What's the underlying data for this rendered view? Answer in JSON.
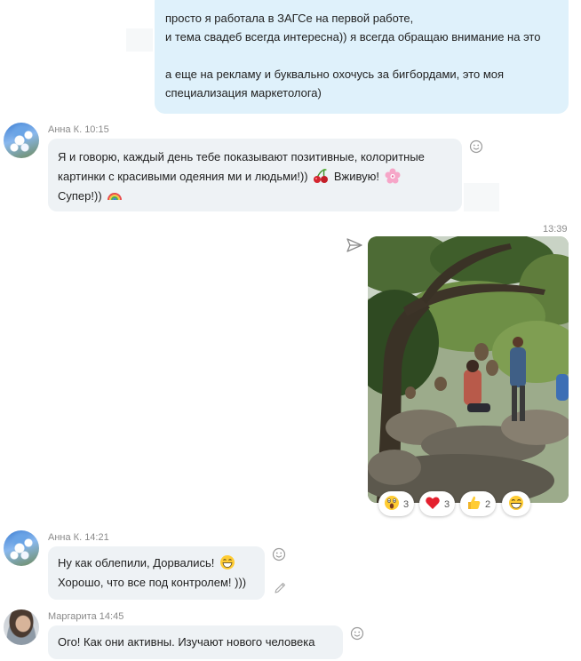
{
  "outgoing_top": {
    "lines": [
      "просто я работала в ЗАГСе на первой работе,",
      "и тема свадеб всегда интересна)) я всегда обращаю внимание на это",
      "",
      "а еще на рекламу и буквально охочусь за бигбордами, это моя",
      "специализация маркетолога)"
    ]
  },
  "messages": [
    {
      "author": "Анна К.",
      "time": "10:15",
      "lines": [
        "Я и говорю, каждый день тебе показывают  позитивные, колоритные",
        "картинки с красивыми одеяния ми и людьми!))",
        "Вживую!",
        "Супер!))"
      ],
      "emojis": [
        "cherries-emoji",
        "cherry-blossom-emoji",
        "rainbow-emoji"
      ]
    },
    {
      "author": "Анна К.",
      "time": "14:21",
      "lines": [
        "Ну как облепили, Дорвались!",
        "Хорошо, что все под контролем! )))"
      ],
      "emojis": [
        "grinning-emoji"
      ]
    },
    {
      "author": "Маргарита",
      "time": "14:45",
      "lines": [
        "Ого! Как они активны. Изучают нового человека"
      ]
    }
  ],
  "photo_message": {
    "time": "13:39",
    "reactions": [
      {
        "icon": "surprised-emoji",
        "count": "3"
      },
      {
        "icon": "heart-emoji",
        "count": "3"
      },
      {
        "icon": "thumbs-up-emoji",
        "count": "2"
      },
      {
        "icon": "laughing-emoji",
        "count": ""
      }
    ]
  },
  "colors": {
    "outgoing_bubble": "#dff1fb",
    "incoming_bubble": "#eef2f5",
    "meta_text": "#8a8a8a"
  }
}
